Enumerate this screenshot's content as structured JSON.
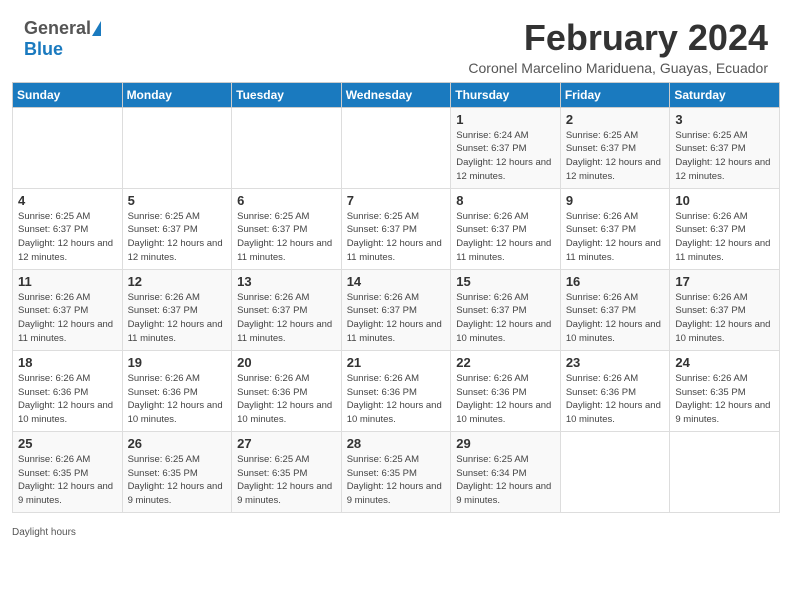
{
  "header": {
    "logo_general": "General",
    "logo_blue": "Blue",
    "title": "February 2024",
    "subtitle": "Coronel Marcelino Mariduena, Guayas, Ecuador"
  },
  "days_of_week": [
    "Sunday",
    "Monday",
    "Tuesday",
    "Wednesday",
    "Thursday",
    "Friday",
    "Saturday"
  ],
  "weeks": [
    [
      {
        "num": "",
        "info": ""
      },
      {
        "num": "",
        "info": ""
      },
      {
        "num": "",
        "info": ""
      },
      {
        "num": "",
        "info": ""
      },
      {
        "num": "1",
        "info": "Sunrise: 6:24 AM\nSunset: 6:37 PM\nDaylight: 12 hours and 12 minutes."
      },
      {
        "num": "2",
        "info": "Sunrise: 6:25 AM\nSunset: 6:37 PM\nDaylight: 12 hours and 12 minutes."
      },
      {
        "num": "3",
        "info": "Sunrise: 6:25 AM\nSunset: 6:37 PM\nDaylight: 12 hours and 12 minutes."
      }
    ],
    [
      {
        "num": "4",
        "info": "Sunrise: 6:25 AM\nSunset: 6:37 PM\nDaylight: 12 hours and 12 minutes."
      },
      {
        "num": "5",
        "info": "Sunrise: 6:25 AM\nSunset: 6:37 PM\nDaylight: 12 hours and 12 minutes."
      },
      {
        "num": "6",
        "info": "Sunrise: 6:25 AM\nSunset: 6:37 PM\nDaylight: 12 hours and 11 minutes."
      },
      {
        "num": "7",
        "info": "Sunrise: 6:25 AM\nSunset: 6:37 PM\nDaylight: 12 hours and 11 minutes."
      },
      {
        "num": "8",
        "info": "Sunrise: 6:26 AM\nSunset: 6:37 PM\nDaylight: 12 hours and 11 minutes."
      },
      {
        "num": "9",
        "info": "Sunrise: 6:26 AM\nSunset: 6:37 PM\nDaylight: 12 hours and 11 minutes."
      },
      {
        "num": "10",
        "info": "Sunrise: 6:26 AM\nSunset: 6:37 PM\nDaylight: 12 hours and 11 minutes."
      }
    ],
    [
      {
        "num": "11",
        "info": "Sunrise: 6:26 AM\nSunset: 6:37 PM\nDaylight: 12 hours and 11 minutes."
      },
      {
        "num": "12",
        "info": "Sunrise: 6:26 AM\nSunset: 6:37 PM\nDaylight: 12 hours and 11 minutes."
      },
      {
        "num": "13",
        "info": "Sunrise: 6:26 AM\nSunset: 6:37 PM\nDaylight: 12 hours and 11 minutes."
      },
      {
        "num": "14",
        "info": "Sunrise: 6:26 AM\nSunset: 6:37 PM\nDaylight: 12 hours and 11 minutes."
      },
      {
        "num": "15",
        "info": "Sunrise: 6:26 AM\nSunset: 6:37 PM\nDaylight: 12 hours and 10 minutes."
      },
      {
        "num": "16",
        "info": "Sunrise: 6:26 AM\nSunset: 6:37 PM\nDaylight: 12 hours and 10 minutes."
      },
      {
        "num": "17",
        "info": "Sunrise: 6:26 AM\nSunset: 6:37 PM\nDaylight: 12 hours and 10 minutes."
      }
    ],
    [
      {
        "num": "18",
        "info": "Sunrise: 6:26 AM\nSunset: 6:36 PM\nDaylight: 12 hours and 10 minutes."
      },
      {
        "num": "19",
        "info": "Sunrise: 6:26 AM\nSunset: 6:36 PM\nDaylight: 12 hours and 10 minutes."
      },
      {
        "num": "20",
        "info": "Sunrise: 6:26 AM\nSunset: 6:36 PM\nDaylight: 12 hours and 10 minutes."
      },
      {
        "num": "21",
        "info": "Sunrise: 6:26 AM\nSunset: 6:36 PM\nDaylight: 12 hours and 10 minutes."
      },
      {
        "num": "22",
        "info": "Sunrise: 6:26 AM\nSunset: 6:36 PM\nDaylight: 12 hours and 10 minutes."
      },
      {
        "num": "23",
        "info": "Sunrise: 6:26 AM\nSunset: 6:36 PM\nDaylight: 12 hours and 10 minutes."
      },
      {
        "num": "24",
        "info": "Sunrise: 6:26 AM\nSunset: 6:35 PM\nDaylight: 12 hours and 9 minutes."
      }
    ],
    [
      {
        "num": "25",
        "info": "Sunrise: 6:26 AM\nSunset: 6:35 PM\nDaylight: 12 hours and 9 minutes."
      },
      {
        "num": "26",
        "info": "Sunrise: 6:25 AM\nSunset: 6:35 PM\nDaylight: 12 hours and 9 minutes."
      },
      {
        "num": "27",
        "info": "Sunrise: 6:25 AM\nSunset: 6:35 PM\nDaylight: 12 hours and 9 minutes."
      },
      {
        "num": "28",
        "info": "Sunrise: 6:25 AM\nSunset: 6:35 PM\nDaylight: 12 hours and 9 minutes."
      },
      {
        "num": "29",
        "info": "Sunrise: 6:25 AM\nSunset: 6:34 PM\nDaylight: 12 hours and 9 minutes."
      },
      {
        "num": "",
        "info": ""
      },
      {
        "num": "",
        "info": ""
      }
    ]
  ],
  "footer": {
    "daylight_hours_label": "Daylight hours"
  }
}
